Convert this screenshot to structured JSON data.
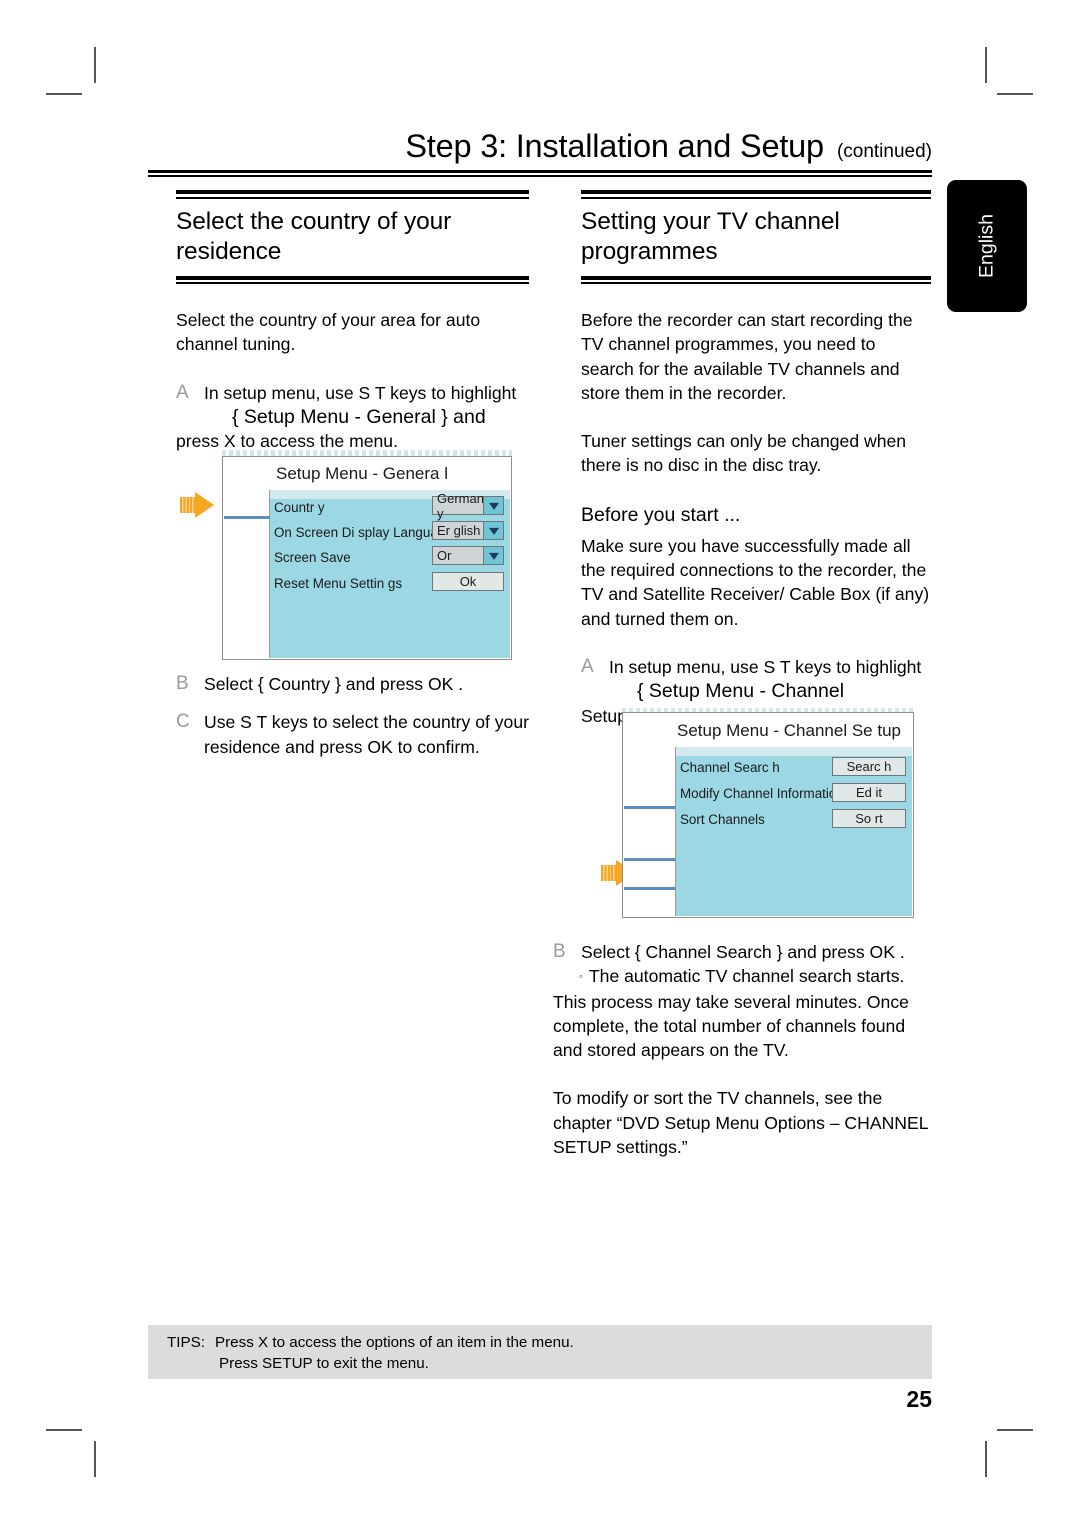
{
  "crop_marks": [
    "top-left",
    "top-right",
    "bottom-left",
    "bottom-right"
  ],
  "header": {
    "step_title": "Step 3: Installation and Setup",
    "continued": "(continued)"
  },
  "language_tab": {
    "label": "English"
  },
  "left_column": {
    "heading": "Select the country of your residence",
    "intro": "Select the country of your area for auto channel tuning.",
    "steps": [
      {
        "marker": "A",
        "line1": "In setup menu, use  S T  keys to highlight",
        "line2": "{ Setup Menu - General  } and",
        "line3": "press  X to access the menu."
      },
      {
        "marker": "B",
        "text": "Select { Country  } and press OK ."
      },
      {
        "marker": "C",
        "text": "Use  S T  keys to select the country of your residence and press OK  to confirm."
      }
    ],
    "osd": {
      "title": "Setup Menu - Genera l",
      "rows": [
        {
          "label": "Countr y",
          "type": "combo",
          "value": "German y"
        },
        {
          "label": "On Screen Di splay Language",
          "type": "combo",
          "value": "Er glish"
        },
        {
          "label": "Screen Save",
          "type": "combo",
          "value": "Or"
        },
        {
          "label": "Reset Menu Settin gs",
          "type": "button",
          "value": "Ok"
        }
      ]
    }
  },
  "right_column": {
    "heading": "Setting your TV channel programmes",
    "para1": "Before the recorder can start recording the TV channel programmes, you need to search for the available TV channels and store them in the recorder.",
    "para2": "Tuner settings can only be changed when there is no disc in the disc tray.",
    "before_you_start": "Before you start ...",
    "para3": "Make sure you have successfully made all the required connections to the recorder, the TV and Satellite Receiver/ Cable Box (if any) and turned them on.",
    "steps": [
      {
        "marker": "A",
        "line1": "In setup menu, use  S T  keys to highlight",
        "line2": "{ Setup Menu - Channel",
        "line3": "Setup } and press  X."
      },
      {
        "marker": "B",
        "text": "Select { Channel Search  } and press OK ."
      }
    ],
    "note_bullet": "The automatic TV channel search starts. This process may take several minutes. Once complete, the total number of channels found and stored appears on the TV.",
    "closing": "To modify or sort the TV channels, see the chapter “DVD Setup Menu Options – CHANNEL SETUP settings.”",
    "osd": {
      "title": "Setup Menu - Channel Se tup",
      "rows": [
        {
          "label": "Channel Searc h",
          "type": "button",
          "value": "Searc h"
        },
        {
          "label": "Modify Channel Informatio n",
          "type": "button",
          "value": "Ed it"
        },
        {
          "label": "Sort Channels",
          "type": "button",
          "value": "So rt"
        }
      ]
    }
  },
  "tips": {
    "label": "TIPS:",
    "line1": "Press  X to access the options of an item in the menu.",
    "line2": "Press SETUP  to exit the menu."
  },
  "page_number": "25",
  "colors": {
    "osd_panel": "#9cd8e4",
    "osd_pale": "#d2eaee",
    "arrow": "#f5a623",
    "tips_bg": "#dcdcdc",
    "tab_bg": "#000000",
    "step_marker": "#9b9b9b"
  }
}
